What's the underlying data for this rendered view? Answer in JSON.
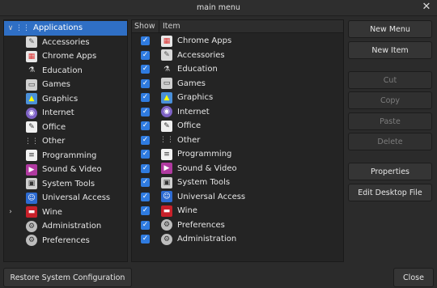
{
  "window": {
    "title": "main menu",
    "close_glyph": "✕"
  },
  "tree": {
    "items": [
      {
        "label": "Applications",
        "icon": "apps-grid-icon",
        "glyph": "⋮⋮",
        "cls": "i-apps",
        "expander": "∨",
        "selected": true
      },
      {
        "label": "Accessories",
        "icon": "accessories-icon",
        "glyph": "✎",
        "cls": "i-acc",
        "expander": ""
      },
      {
        "label": "Chrome Apps",
        "icon": "chrome-apps-icon",
        "glyph": "▦",
        "cls": "i-chrome",
        "expander": ""
      },
      {
        "label": "Education",
        "icon": "education-icon",
        "glyph": "⚗",
        "cls": "i-edu",
        "expander": ""
      },
      {
        "label": "Games",
        "icon": "games-icon",
        "glyph": "▭",
        "cls": "i-games",
        "expander": ""
      },
      {
        "label": "Graphics",
        "icon": "graphics-icon",
        "glyph": "▲",
        "cls": "i-gfx",
        "expander": ""
      },
      {
        "label": "Internet",
        "icon": "internet-icon",
        "glyph": "◉",
        "cls": "i-net",
        "expander": ""
      },
      {
        "label": "Office",
        "icon": "office-icon",
        "glyph": "✎",
        "cls": "i-office",
        "expander": ""
      },
      {
        "label": "Other",
        "icon": "other-icon",
        "glyph": "⋮⋮",
        "cls": "i-other",
        "expander": ""
      },
      {
        "label": "Programming",
        "icon": "programming-icon",
        "glyph": "≡",
        "cls": "i-prog",
        "expander": ""
      },
      {
        "label": "Sound & Video",
        "icon": "sound-video-icon",
        "glyph": "▶",
        "cls": "i-sound",
        "expander": ""
      },
      {
        "label": "System Tools",
        "icon": "system-tools-icon",
        "glyph": "▣",
        "cls": "i-sys",
        "expander": ""
      },
      {
        "label": "Universal Access",
        "icon": "universal-access-icon",
        "glyph": "☺",
        "cls": "i-ua",
        "expander": ""
      },
      {
        "label": "Wine",
        "icon": "wine-icon",
        "glyph": "▬",
        "cls": "i-wine",
        "expander": "›"
      },
      {
        "label": "Administration",
        "icon": "administration-icon",
        "glyph": "⚙",
        "cls": "i-admin",
        "expander": ""
      },
      {
        "label": "Preferences",
        "icon": "preferences-icon",
        "glyph": "⚙",
        "cls": "i-pref",
        "expander": ""
      }
    ]
  },
  "list": {
    "col_show": "Show",
    "col_item": "Item",
    "check_glyph": "✓",
    "items": [
      {
        "label": "Chrome Apps",
        "icon": "chrome-apps-icon",
        "glyph": "▦",
        "cls": "i-chrome",
        "checked": true
      },
      {
        "label": "Accessories",
        "icon": "accessories-icon",
        "glyph": "✎",
        "cls": "i-acc",
        "checked": true
      },
      {
        "label": "Education",
        "icon": "education-icon",
        "glyph": "⚗",
        "cls": "i-edu",
        "checked": true
      },
      {
        "label": "Games",
        "icon": "games-icon",
        "glyph": "▭",
        "cls": "i-games",
        "checked": true
      },
      {
        "label": "Graphics",
        "icon": "graphics-icon",
        "glyph": "▲",
        "cls": "i-gfx",
        "checked": true
      },
      {
        "label": "Internet",
        "icon": "internet-icon",
        "glyph": "◉",
        "cls": "i-net",
        "checked": true
      },
      {
        "label": "Office",
        "icon": "office-icon",
        "glyph": "✎",
        "cls": "i-office",
        "checked": true
      },
      {
        "label": "Other",
        "icon": "other-icon",
        "glyph": "⋮⋮",
        "cls": "i-other",
        "checked": true
      },
      {
        "label": "Programming",
        "icon": "programming-icon",
        "glyph": "≡",
        "cls": "i-prog",
        "checked": true
      },
      {
        "label": "Sound & Video",
        "icon": "sound-video-icon",
        "glyph": "▶",
        "cls": "i-sound",
        "checked": true
      },
      {
        "label": "System Tools",
        "icon": "system-tools-icon",
        "glyph": "▣",
        "cls": "i-sys",
        "checked": true
      },
      {
        "label": "Universal Access",
        "icon": "universal-access-icon",
        "glyph": "☺",
        "cls": "i-ua",
        "checked": true
      },
      {
        "label": "Wine",
        "icon": "wine-icon",
        "glyph": "▬",
        "cls": "i-wine",
        "checked": true
      },
      {
        "label": "Preferences",
        "icon": "preferences-icon",
        "glyph": "⚙",
        "cls": "i-pref",
        "checked": true
      },
      {
        "label": "Administration",
        "icon": "administration-icon",
        "glyph": "⚙",
        "cls": "i-admin",
        "checked": true
      }
    ]
  },
  "actions": {
    "new_menu": "New Menu",
    "new_item": "New Item",
    "cut": "Cut",
    "copy": "Copy",
    "paste": "Paste",
    "delete": "Delete",
    "properties": "Properties",
    "edit_desktop_file": "Edit Desktop File"
  },
  "footer": {
    "restore": "Restore System Configuration",
    "close": "Close"
  }
}
